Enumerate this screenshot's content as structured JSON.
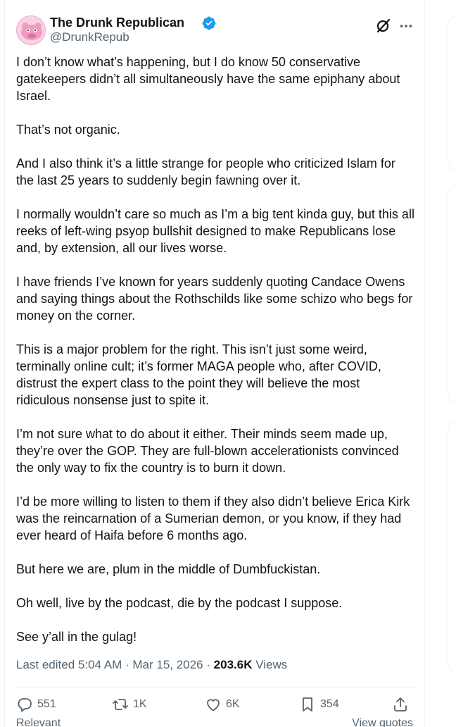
{
  "author": {
    "name": "The Drunk Republican",
    "handle": "@DrunkRepub",
    "verified": true,
    "accent": "#1d9bf0"
  },
  "tweet": {
    "paragraphs": [
      "I don’t know what’s happening, but I do know 50 conservative gatekeepers didn’t all simultaneously have the same epiphany about Israel.",
      "That’s not organic.",
      "And I also think it’s a little strange for people who criticized Islam for the last 25  years to suddenly begin fawning over it.",
      "I normally wouldn’t care so much as I’m a big tent kinda guy, but this all reeks of left-wing psyop bullshit designed to make Republicans lose and, by extension, all our lives worse.",
      "I have friends I’ve known for years suddenly quoting Candace Owens and saying things about the Rothschilds like some schizo who begs for money on the corner.",
      "This is a major problem for the right. This isn’t just some weird, terminally online cult; it’s former MAGA people who, after COVID, distrust the expert class to the point they will believe the most ridiculous nonsense just to spite it.",
      "I’m not sure what to do about it either. Their minds seem made up, they’re over the GOP. They are full-blown accelerationists convinced the only way to fix the country is to burn it down.",
      "I’d be more willing to listen to them if they also didn’t believe Erica Kirk was the reincarnation of a Sumerian demon, or you know, if they had ever heard of Haifa before 6 months ago.",
      "But here we are, plum in the middle of Dumbfuckistan.",
      "Oh well, live by the podcast, die by the podcast I suppose.",
      "See y’all in the gulag!"
    ],
    "edited_label": "Last edited 5:04 AM · Mar 15, 2026 · ",
    "views_count": "203.6K",
    "views_label": " Views"
  },
  "actions": {
    "replies": "551",
    "reposts": "1K",
    "likes": "6K",
    "bookmarks": "354"
  },
  "footer": {
    "sort_label": "Relevant",
    "quotes_label": "View quotes"
  },
  "icons": [
    "verified-badge-icon",
    "grok-icon",
    "more-icon",
    "reply-icon",
    "repost-icon",
    "like-icon",
    "bookmark-icon",
    "share-icon"
  ]
}
